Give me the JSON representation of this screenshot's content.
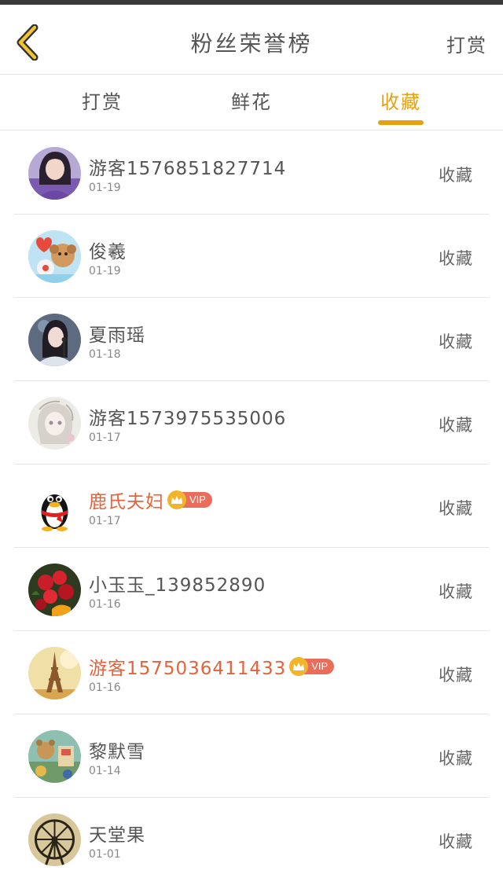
{
  "header": {
    "title": "粉丝荣誉榜",
    "right_action": "打赏"
  },
  "tabs": [
    {
      "label": "打赏",
      "active": false
    },
    {
      "label": "鲜花",
      "active": false
    },
    {
      "label": "收藏",
      "active": true
    }
  ],
  "colors": {
    "accent": "#e8a013",
    "vip_name": "#e6623a",
    "vip_badge": "#ea6c5a"
  },
  "fans": [
    {
      "name": "游客1576851827714",
      "date": "01-19",
      "action": "收藏",
      "vip": false,
      "avatar": "girl-portrait-avatar"
    },
    {
      "name": "俊羲",
      "date": "01-19",
      "action": "收藏",
      "vip": false,
      "avatar": "cartoon-dogs-avatar"
    },
    {
      "name": "夏雨瑶",
      "date": "01-18",
      "action": "收藏",
      "vip": false,
      "avatar": "singer-portrait-avatar"
    },
    {
      "name": "游客1573975535006",
      "date": "01-17",
      "action": "收藏",
      "vip": false,
      "avatar": "sketch-girl-avatar"
    },
    {
      "name": "鹿氏夫妇",
      "date": "01-17",
      "action": "收藏",
      "vip": true,
      "vip_label": "VIP",
      "avatar": "qq-penguin-avatar"
    },
    {
      "name": "小玉玉_139852890",
      "date": "01-16",
      "action": "收藏",
      "vip": false,
      "avatar": "roses-avatar"
    },
    {
      "name": "游客1575036411433",
      "date": "01-16",
      "action": "收藏",
      "vip": true,
      "vip_label": "VIP",
      "avatar": "eiffel-tower-avatar"
    },
    {
      "name": "黎默雪",
      "date": "01-14",
      "action": "收藏",
      "vip": false,
      "avatar": "cartoon-bear-avatar"
    },
    {
      "name": "天堂果",
      "date": "01-01",
      "action": "收藏",
      "vip": false,
      "avatar": "ferris-wheel-avatar"
    }
  ]
}
